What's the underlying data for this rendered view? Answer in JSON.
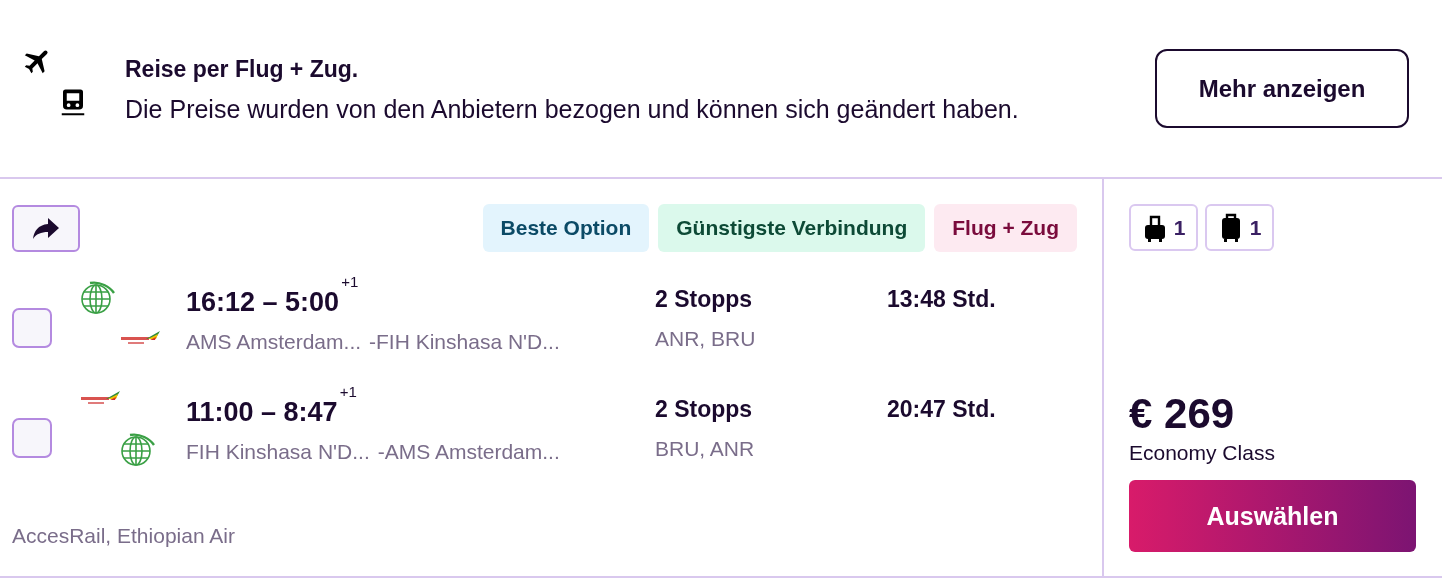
{
  "banner": {
    "title": "Reise per Flug + Zug.",
    "text": "Die Preise wurden von den Anbietern bezogen und können sich geändert haben.",
    "button": "Mehr anzeigen"
  },
  "result": {
    "tags": [
      {
        "label": "Beste Option",
        "kind": "best"
      },
      {
        "label": "Günstigste Verbindung",
        "kind": "cheapest"
      },
      {
        "label": "Flug + Zug",
        "kind": "combo"
      }
    ],
    "legs": [
      {
        "checked": false,
        "logos": [
          {
            "kind": "globe"
          },
          {
            "kind": "ethiopian"
          }
        ],
        "times": "16:12 – 5:00",
        "day_offset": "+1",
        "origin": "AMS Amsterdam...",
        "destination": "-FIH Kinshasa N'D...",
        "stops": "2 Stopps",
        "via": "ANR, BRU",
        "duration": "13:48 Std."
      },
      {
        "checked": false,
        "logos": [
          {
            "kind": "ethiopian"
          },
          {
            "kind": "globe"
          }
        ],
        "times": "11:00 – 8:47",
        "day_offset": "+1",
        "origin": "FIH Kinshasa N'D...",
        "destination": "-AMS Amsterdam...",
        "stops": "2 Stopps",
        "via": "BRU, ANR",
        "duration": "20:47 Std."
      }
    ],
    "carriers": "AccesRail, Ethiopian Air",
    "baggage": [
      {
        "kind": "personal",
        "count": "1"
      },
      {
        "kind": "carry_on",
        "count": "1"
      }
    ],
    "price": "€ 269",
    "cabin": "Economy Class",
    "select_button": "Auswählen"
  }
}
